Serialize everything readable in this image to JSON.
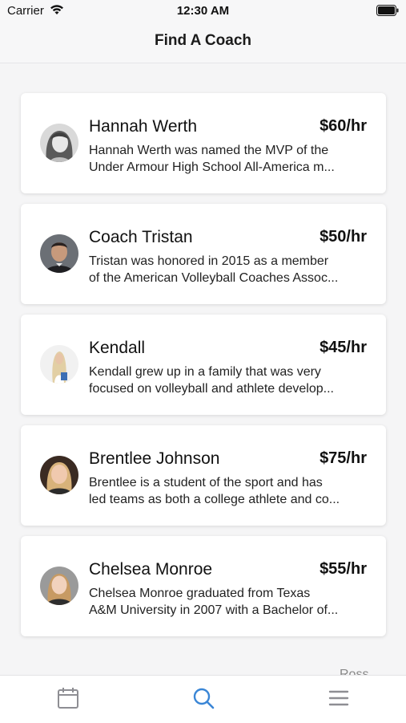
{
  "status_bar": {
    "carrier": "Carrier",
    "time": "12:30 AM"
  },
  "nav": {
    "title": "Find A Coach"
  },
  "coaches": [
    {
      "name": "Hannah Werth",
      "rate": "$60/hr",
      "bio_line1": "Hannah Werth was named the MVP of the",
      "bio_line2": "Under Armour High School All-America m..."
    },
    {
      "name": "Coach Tristan",
      "rate": "$50/hr",
      "bio_line1": "Tristan was honored in 2015 as a member",
      "bio_line2": "of the American Volleyball Coaches Assoc..."
    },
    {
      "name": "Kendall",
      "rate": "$45/hr",
      "bio_line1": "Kendall grew up in a family that was very",
      "bio_line2": "focused on volleyball and athlete develop..."
    },
    {
      "name": "Brentlee Johnson",
      "rate": "$75/hr",
      "bio_line1": "Brentlee is a student of the sport and has",
      "bio_line2": "led teams as both a college athlete and co..."
    },
    {
      "name": "Chelsea Monroe",
      "rate": "$55/hr",
      "bio_line1": "Chelsea Monroe graduated from Texas",
      "bio_line2": "A&M University in 2007 with a Bachelor of..."
    }
  ],
  "peek_text": "Ross",
  "tab_bar": {
    "tabs": [
      {
        "icon": "calendar-icon",
        "active": false
      },
      {
        "icon": "search-icon",
        "active": true
      },
      {
        "icon": "menu-icon",
        "active": false
      }
    ],
    "active_color": "#3a86d6",
    "inactive_color": "#8e8e93"
  }
}
